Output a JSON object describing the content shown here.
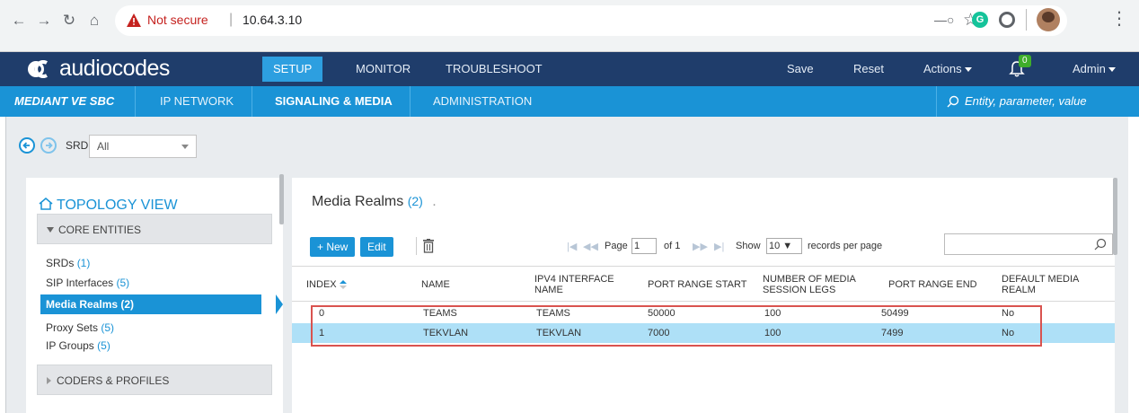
{
  "browser": {
    "not_secure": "Not secure",
    "url": "10.64.3.10",
    "extension_g": "G"
  },
  "header": {
    "logo_text": "audiocodes",
    "nav": [
      "SETUP",
      "MONITOR",
      "TROUBLESHOOT"
    ],
    "active_nav": "SETUP",
    "save": "Save",
    "reset": "Reset",
    "actions": "Actions",
    "notifications": "0",
    "admin": "Admin"
  },
  "subheader": {
    "product": "MEDIANT VE SBC",
    "tabs": [
      "IP NETWORK",
      "SIGNALING & MEDIA",
      "ADMINISTRATION"
    ],
    "active_tab": "SIGNALING & MEDIA",
    "search_placeholder": "Entity, parameter, value"
  },
  "srd": {
    "label": "SRD",
    "value": "All"
  },
  "topology": {
    "title": "TOPOLOGY VIEW",
    "core_entities": "CORE ENTITIES",
    "items": [
      {
        "label": "SRDs",
        "count": "(1)"
      },
      {
        "label": "SIP Interfaces",
        "count": "(5)"
      },
      {
        "label": "Media Realms",
        "count": "(2)"
      },
      {
        "label": "Proxy Sets",
        "count": "(5)"
      },
      {
        "label": "IP Groups",
        "count": "(5)"
      }
    ],
    "coders_profiles": "CODERS & PROFILES"
  },
  "media_realms": {
    "title": "Media Realms",
    "count": "(2)",
    "dot": ".",
    "new_button": "+ New",
    "edit_button": "Edit",
    "pager": {
      "page_label": "Page",
      "page_value": "1",
      "of_label": "of 1",
      "show_label": "Show",
      "show_value": "10",
      "records_label": "records per page"
    },
    "columns": [
      "INDEX",
      "NAME",
      "IPV4 INTERFACE NAME",
      "PORT RANGE START",
      "NUMBER OF MEDIA SESSION LEGS",
      "PORT RANGE END",
      "DEFAULT MEDIA REALM"
    ],
    "rows": [
      [
        "0",
        "TEAMS",
        "TEAMS",
        "50000",
        "100",
        "50499",
        "No"
      ],
      [
        "1",
        "TEKVLAN",
        "TEKVLAN",
        "7000",
        "100",
        "7499",
        "No"
      ]
    ]
  },
  "colors": {
    "header_bg": "#1f3d6b",
    "subbar_bg": "#1a93d6",
    "accent": "#1a93d6",
    "selected_row": "#aee0f7",
    "annotation_red": "#d9534f"
  }
}
